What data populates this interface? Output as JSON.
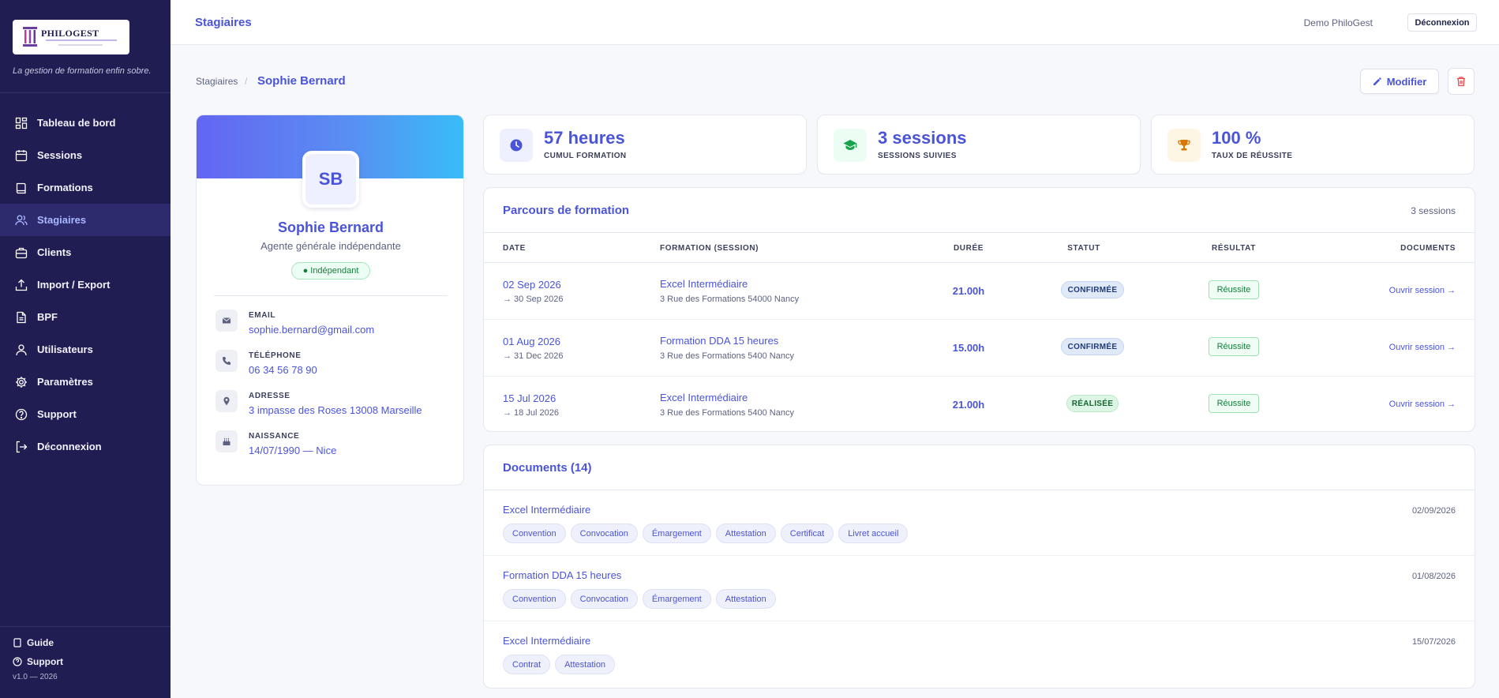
{
  "app": {
    "logo_text": "PHILOGEST",
    "tagline": "La gestion de formation enfin sobre."
  },
  "sidebar": {
    "items": [
      {
        "label": "Tableau de bord",
        "icon": "grid-icon"
      },
      {
        "label": "Sessions",
        "icon": "calendar-icon"
      },
      {
        "label": "Formations",
        "icon": "book-icon"
      },
      {
        "label": "Stagiaires",
        "icon": "users-icon",
        "active": true
      },
      {
        "label": "Clients",
        "icon": "briefcase-icon"
      },
      {
        "label": "Import / Export",
        "icon": "upload-icon"
      },
      {
        "label": "BPF",
        "icon": "document-icon"
      },
      {
        "label": "Utilisateurs",
        "icon": "user-icon"
      },
      {
        "label": "Paramètres",
        "icon": "gear-icon"
      },
      {
        "label": "Support",
        "icon": "help-icon"
      },
      {
        "label": "Déconnexion",
        "icon": "logout-icon"
      }
    ],
    "bottom": {
      "guide": "Guide",
      "support": "Support",
      "version": "v1.0 — 2026"
    }
  },
  "topbar": {
    "title": "Stagiaires",
    "user": "Demo PhiloGest",
    "logout": "Déconnexion"
  },
  "header": {
    "breadcrumb_parent": "Stagiaires",
    "breadcrumb_sep": "/",
    "breadcrumb_current": "Sophie Bernard",
    "edit_label": "Modifier"
  },
  "profile": {
    "initials": "SB",
    "name": "Sophie Bernard",
    "role": "Agente générale indépendante",
    "badge": "● Indépendant",
    "email_label": "EMAIL",
    "email": "sophie.bernard@gmail.com",
    "phone_label": "TÉLÉPHONE",
    "phone": "06 34 56 78 90",
    "address_label": "ADRESSE",
    "address": "3 impasse des Roses 13008 Marseille",
    "birth_label": "NAISSANCE",
    "birth": "14/07/1990 — Nice"
  },
  "stats": [
    {
      "value": "57 heures",
      "label": "CUMUL FORMATION",
      "icon": "clock-icon",
      "color": "#4a54d8",
      "bg": "#eef0ff"
    },
    {
      "value": "3 sessions",
      "label": "SESSIONS SUIVIES",
      "icon": "graduation-cap-icon",
      "color": "#16a34a",
      "bg": "#ecfdf3"
    },
    {
      "value": "100 %",
      "label": "TAUX DE RÉUSSITE",
      "icon": "trophy-icon",
      "color": "#d97706",
      "bg": "#fef6e4"
    }
  ],
  "parcours": {
    "title": "Parcours de formation",
    "count": "3 sessions",
    "columns": [
      "DATE",
      "FORMATION (SESSION)",
      "DURÉE",
      "STATUT",
      "RÉSULTAT",
      "DOCUMENTS"
    ],
    "rows": [
      {
        "date": "02 Sep 2026",
        "end": "→ 30 Sep 2026",
        "formation": "Excel Intermédiaire",
        "address": "3 Rue des Formations 54000 Nancy",
        "duration": "21.00h",
        "status": "CONFIRMÉE",
        "result": "Réussite",
        "link": "Ouvrir session →"
      },
      {
        "date": "01 Aug 2026",
        "end": "→ 31 Dec 2026",
        "formation": "Formation DDA 15 heures",
        "address": "3 Rue des Formations 5400 Nancy",
        "duration": "15.00h",
        "status": "CONFIRMÉE",
        "result": "Réussite",
        "link": "Ouvrir session →"
      },
      {
        "date": "15 Jul 2026",
        "end": "→ 18 Jul 2026",
        "formation": "Excel Intermédiaire",
        "address": "3 Rue des Formations 5400 Nancy",
        "duration": "21.00h",
        "status": "RÉALISÉE",
        "result": "Réussite",
        "link": "Ouvrir session →"
      }
    ]
  },
  "documents": {
    "title": "Documents (14)",
    "groups": [
      {
        "title": "Excel Intermédiaire",
        "date": "02/09/2026",
        "chips": [
          "Convention",
          "Convocation",
          "Émargement",
          "Attestation",
          "Certificat",
          "Livret accueil"
        ]
      },
      {
        "title": "Formation DDA 15 heures",
        "date": "01/08/2026",
        "chips": [
          "Convention",
          "Convocation",
          "Émargement",
          "Attestation"
        ]
      },
      {
        "title": "Excel Intermédiaire",
        "date": "15/07/2026",
        "chips": [
          "Contrat",
          "Attestation"
        ]
      }
    ]
  }
}
